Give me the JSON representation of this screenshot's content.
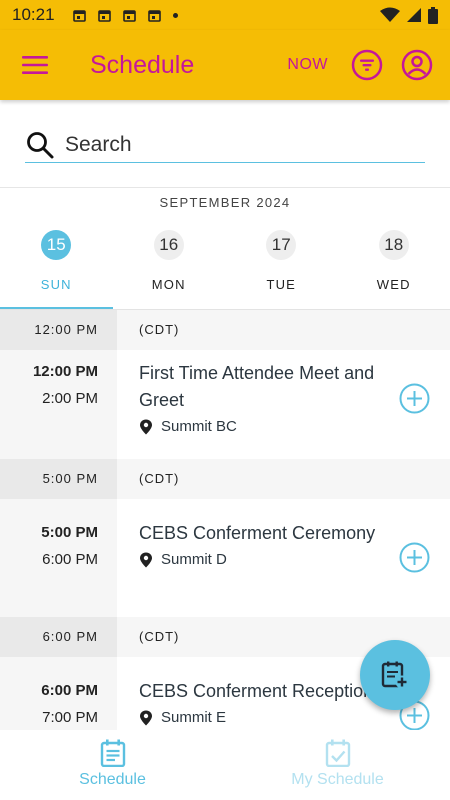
{
  "status_bar": {
    "time": "10:21",
    "icons": [
      "calendar-icon",
      "calendar-icon",
      "calendar-icon",
      "calendar-icon",
      "dot-icon",
      "wifi-icon",
      "signal-icon",
      "battery-icon"
    ]
  },
  "app_bar": {
    "title": "Schedule",
    "now_label": "NOW",
    "colors": {
      "background": "#f5bd05",
      "accent": "#c5179a"
    }
  },
  "search": {
    "placeholder": "Search",
    "value": ""
  },
  "calendar": {
    "month": "SEPTEMBER 2024",
    "days": [
      {
        "num": "15",
        "name": "SUN",
        "active": true
      },
      {
        "num": "16",
        "name": "MON",
        "active": false
      },
      {
        "num": "17",
        "name": "TUE",
        "active": false
      },
      {
        "num": "18",
        "name": "WED",
        "active": false
      }
    ]
  },
  "schedule": {
    "groups": [
      {
        "header_time": "12:00 PM",
        "timezone": "(CDT)",
        "events": [
          {
            "start": "12:00 PM",
            "end": "2:00 PM",
            "title": "First Time Attendee Meet and Greet",
            "location": "Summit BC"
          }
        ]
      },
      {
        "header_time": "5:00 PM",
        "timezone": "(CDT)",
        "events": [
          {
            "start": "5:00 PM",
            "end": "6:00 PM",
            "title": "CEBS Conferment Ceremony",
            "location": "Summit D"
          }
        ]
      },
      {
        "header_time": "6:00 PM",
        "timezone": "(CDT)",
        "events": [
          {
            "start": "6:00 PM",
            "end": "7:00 PM",
            "title": "CEBS Conferment Reception",
            "location": "Summit E"
          }
        ]
      }
    ]
  },
  "bottom_nav": {
    "items": [
      {
        "label": "Schedule",
        "active": true
      },
      {
        "label": "My Schedule",
        "active": false
      }
    ]
  },
  "accent_color": "#5bc0e0"
}
